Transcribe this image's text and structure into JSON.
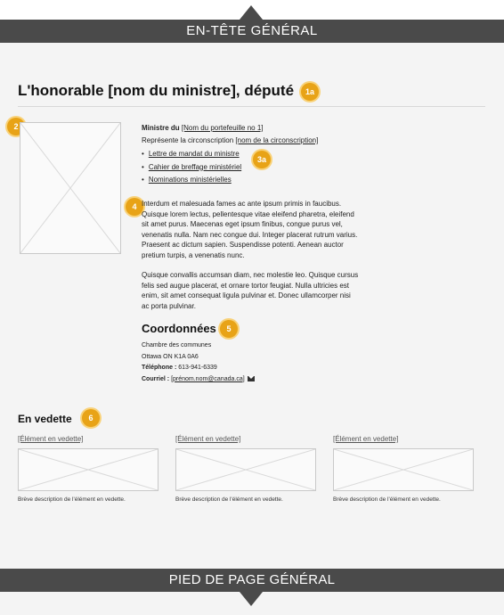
{
  "header": {
    "label": "EN-TÊTE GÉNÉRAL"
  },
  "footer": {
    "label": "PIED DE PAGE GÉNÉRAL"
  },
  "title": "L'honorable [nom du ministre], député",
  "badges": {
    "title": "1a",
    "photo": "2",
    "links": "3a",
    "bio": "4",
    "contact": "5",
    "featured": "6"
  },
  "info": {
    "minister_prefix": "Ministre du ",
    "portfolio": "[Nom du portefeuille no 1]",
    "riding_prefix": "Représente la circonscription ",
    "riding": "[nom de la circonscription]",
    "links": [
      "Lettre de mandat du ministre",
      "Cahier de breffage ministériel",
      "Nominations ministérielles"
    ]
  },
  "bio": {
    "p1": "Interdum et malesuada fames ac ante ipsum primis in faucibus. Quisque lorem lectus, pellentesque vitae eleifend pharetra, eleifend sit amet purus. Maecenas eget ipsum finibus, congue purus vel, venenatis nulla. Nam nec congue dui. Integer placerat rutrum varius. Praesent ac dictum sapien. Suspendisse potenti. Aenean auctor pretium turpis, a venenatis nunc.",
    "p2": "Quisque convallis accumsan diam, nec molestie leo. Quisque cursus felis sed augue placerat, et ornare tortor feugiat. Nulla ultricies est enim, sit amet consequat ligula pulvinar et. Donec ullamcorper nisi ac porta pulvinar."
  },
  "contact": {
    "heading": "Coordonnées",
    "line1": "Chambre des communes",
    "line2": "Ottawa ON  K1A 0A6",
    "phone_label": "Téléphone : ",
    "phone": "613-941-6339",
    "email_label": "Courriel : ",
    "email": "[prénom.nom@canada.ca]"
  },
  "featured": {
    "heading": "En vedette",
    "items": [
      {
        "title": "[Élément en vedette]",
        "desc": "Brève description de l'élément en vedette."
      },
      {
        "title": "[Élément en vedette]",
        "desc": "Brève description de l'élément en vedette."
      },
      {
        "title": "[Élément en vedette]",
        "desc": "Brève description de l'élément en vedette."
      }
    ]
  },
  "colors": {
    "bar": "#4a4a4a",
    "badge": "#e8a317",
    "page": "#f4f4f4"
  }
}
